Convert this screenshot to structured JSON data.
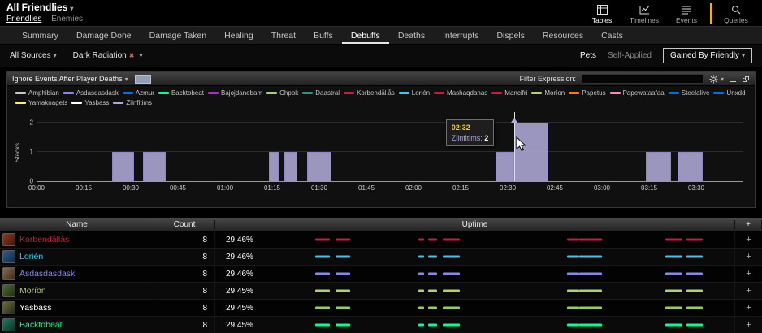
{
  "topbar": {
    "title": "All Friendlies",
    "friendlies": "Friendlies",
    "enemies": "Enemies",
    "views": [
      {
        "label": "Tables",
        "icon": "tables-icon",
        "active": true
      },
      {
        "label": "Timelines",
        "icon": "timelines-icon",
        "active": false
      },
      {
        "label": "Events",
        "icon": "events-icon",
        "active": false
      },
      {
        "label": "Queries",
        "icon": "queries-icon",
        "active": false,
        "divider": true
      }
    ]
  },
  "tabs": {
    "items": [
      "Summary",
      "Damage Done",
      "Damage Taken",
      "Healing",
      "Threat",
      "Buffs",
      "Debuffs",
      "Deaths",
      "Interrupts",
      "Dispels",
      "Resources",
      "Casts"
    ],
    "active": "Debuffs"
  },
  "filterbar": {
    "source_dropdown": "All Sources",
    "ability_filter": "Dark Radiation",
    "pets": "Pets",
    "self_applied": "Self-Applied",
    "gained_by": "Gained By Friendly"
  },
  "panel": {
    "death_dropdown": "Ignore Events After Player Deaths",
    "filter_expression_label": "Filter Expression:",
    "filter_expression_value": ""
  },
  "legend": [
    {
      "name": "Amphibian",
      "color": "#c9c9c9"
    },
    {
      "name": "Asdasdasdask",
      "color": "#8788EE"
    },
    {
      "name": "Azmur",
      "color": "#0070DD"
    },
    {
      "name": "Backtobeat",
      "color": "#00FF98"
    },
    {
      "name": "Bajojdanebam",
      "color": "#A330C9"
    },
    {
      "name": "Chpok",
      "color": "#AAD372"
    },
    {
      "name": "Daastral",
      "color": "#33937F"
    },
    {
      "name": "Korbendållås",
      "color": "#C41E3A"
    },
    {
      "name": "Lorién",
      "color": "#3FC7EB"
    },
    {
      "name": "Mashaqdanas",
      "color": "#C41E3A"
    },
    {
      "name": "Mancifri",
      "color": "#C41E3A"
    },
    {
      "name": "Moríon",
      "color": "#AAD372"
    },
    {
      "name": "Papetus",
      "color": "#FF7C0A"
    },
    {
      "name": "Papewataafaa",
      "color": "#F48CBA"
    },
    {
      "name": "Steelalive",
      "color": "#0070DD"
    },
    {
      "name": "Unxdd",
      "color": "#0070DD"
    },
    {
      "name": "Yamaknagets",
      "color": "#FFF468"
    },
    {
      "name": "Yasbass",
      "color": "#FFFFFF"
    },
    {
      "name": "Zilnfitims",
      "color": "#AEA8D3"
    }
  ],
  "chart_data": {
    "type": "area",
    "title": "Debuff stacks over time",
    "ylabel": "Stacks",
    "yticks": [
      0,
      1,
      2
    ],
    "ymax": 2.35,
    "x_ticks": [
      "00:00",
      "00:15",
      "00:30",
      "00:45",
      "01:00",
      "01:15",
      "01:30",
      "01:45",
      "02:00",
      "02:15",
      "02:30",
      "02:45",
      "03:00",
      "03:15",
      "03:30"
    ],
    "tick_interval_seconds": 15,
    "xmax_seconds": 225,
    "series_color": "#AEA8D3",
    "intervals": [
      {
        "start": 24,
        "end": 31,
        "stacks": 1
      },
      {
        "start": 34,
        "end": 41,
        "stacks": 1
      },
      {
        "start": 74,
        "end": 77,
        "stacks": 1
      },
      {
        "start": 79,
        "end": 83,
        "stacks": 1
      },
      {
        "start": 86,
        "end": 94,
        "stacks": 1
      },
      {
        "start": 146,
        "end": 152,
        "stacks": 1
      },
      {
        "start": 152,
        "end": 163,
        "stacks": 2
      },
      {
        "start": 194,
        "end": 202,
        "stacks": 1
      },
      {
        "start": 204,
        "end": 212,
        "stacks": 1
      }
    ],
    "crosshair_seconds": 152,
    "hover": {
      "time": "02:32",
      "series": "Zilnfitims",
      "series_label": "Zilnfitims:",
      "value": 2
    }
  },
  "table": {
    "headers": {
      "name": "Name",
      "count": "Count",
      "uptime": "Uptime",
      "expand": "+"
    },
    "rows": [
      {
        "name": "Korbendållås",
        "color": "#C41E3A",
        "count": "8",
        "uptime": "29.46%",
        "bar_color": "#C41E3A",
        "icon": [
          "#8a3b20",
          "#40160b"
        ]
      },
      {
        "name": "Lorién",
        "color": "#3FC7EB",
        "count": "8",
        "uptime": "29.46%",
        "bar_color": "#3FC7EB",
        "icon": [
          "#2b5d8f",
          "#122a45"
        ]
      },
      {
        "name": "Asdasdasdask",
        "color": "#8788EE",
        "count": "8",
        "uptime": "29.46%",
        "bar_color": "#8788EE",
        "icon": [
          "#8a6d4e",
          "#3c2b1a"
        ]
      },
      {
        "name": "Moríon",
        "color": "#AAD372",
        "count": "8",
        "uptime": "29.45%",
        "bar_color": "#AAD372",
        "icon": [
          "#4e6b2e",
          "#1f2e10"
        ]
      },
      {
        "name": "Yasbass",
        "color": "#FFFFFF",
        "count": "8",
        "uptime": "29.45%",
        "bar_color": "#93CE5F",
        "icon": [
          "#6b6b3a",
          "#2a2a14"
        ]
      },
      {
        "name": "Backtobeat",
        "color": "#00FF98",
        "count": "8",
        "uptime": "29.45%",
        "bar_color": "#00FF98",
        "icon": [
          "#1f7a5e",
          "#0b3327"
        ]
      }
    ]
  }
}
